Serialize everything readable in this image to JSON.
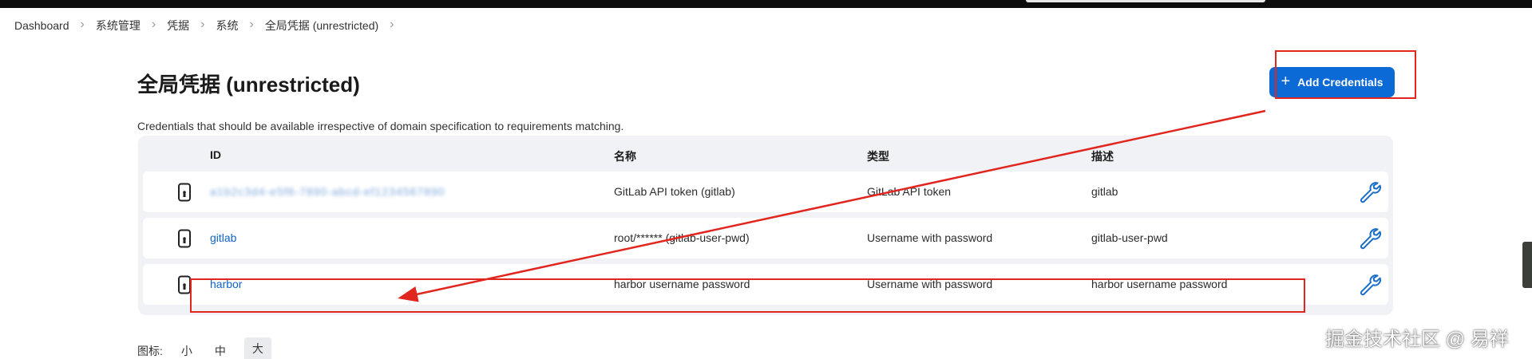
{
  "breadcrumb": [
    "Dashboard",
    "系统管理",
    "凭据",
    "系统",
    "全局凭据 (unrestricted)"
  ],
  "page": {
    "title": "全局凭据 (unrestricted)",
    "add_button_label": "Add Credentials",
    "description": "Credentials that should be available irrespective of domain specification to requirements matching."
  },
  "table": {
    "headers": {
      "id": "ID",
      "name": "名称",
      "type": "类型",
      "description": "描述"
    },
    "rows": [
      {
        "id": "a1b2c3d4-e5f6-7890-abcd-ef1234567890",
        "id_blurred": true,
        "name": "GitLab API token (gitlab)",
        "type": "GitLab API token",
        "description": "gitlab"
      },
      {
        "id": "gitlab",
        "id_blurred": false,
        "name": "root/****** (gitlab-user-pwd)",
        "type": "Username with password",
        "description": "gitlab-user-pwd"
      },
      {
        "id": "harbor",
        "id_blurred": false,
        "name": "harbor username password",
        "type": "Username with password",
        "description": "harbor username password"
      }
    ]
  },
  "icon_size": {
    "label": "图标:",
    "options": [
      "小",
      "中",
      "大"
    ],
    "selected": "大"
  },
  "watermark": "掘金技术社区 @ 易祥",
  "colors": {
    "accent": "#0b6ad6",
    "link": "#1064c8",
    "annotation": "#e0261f"
  }
}
